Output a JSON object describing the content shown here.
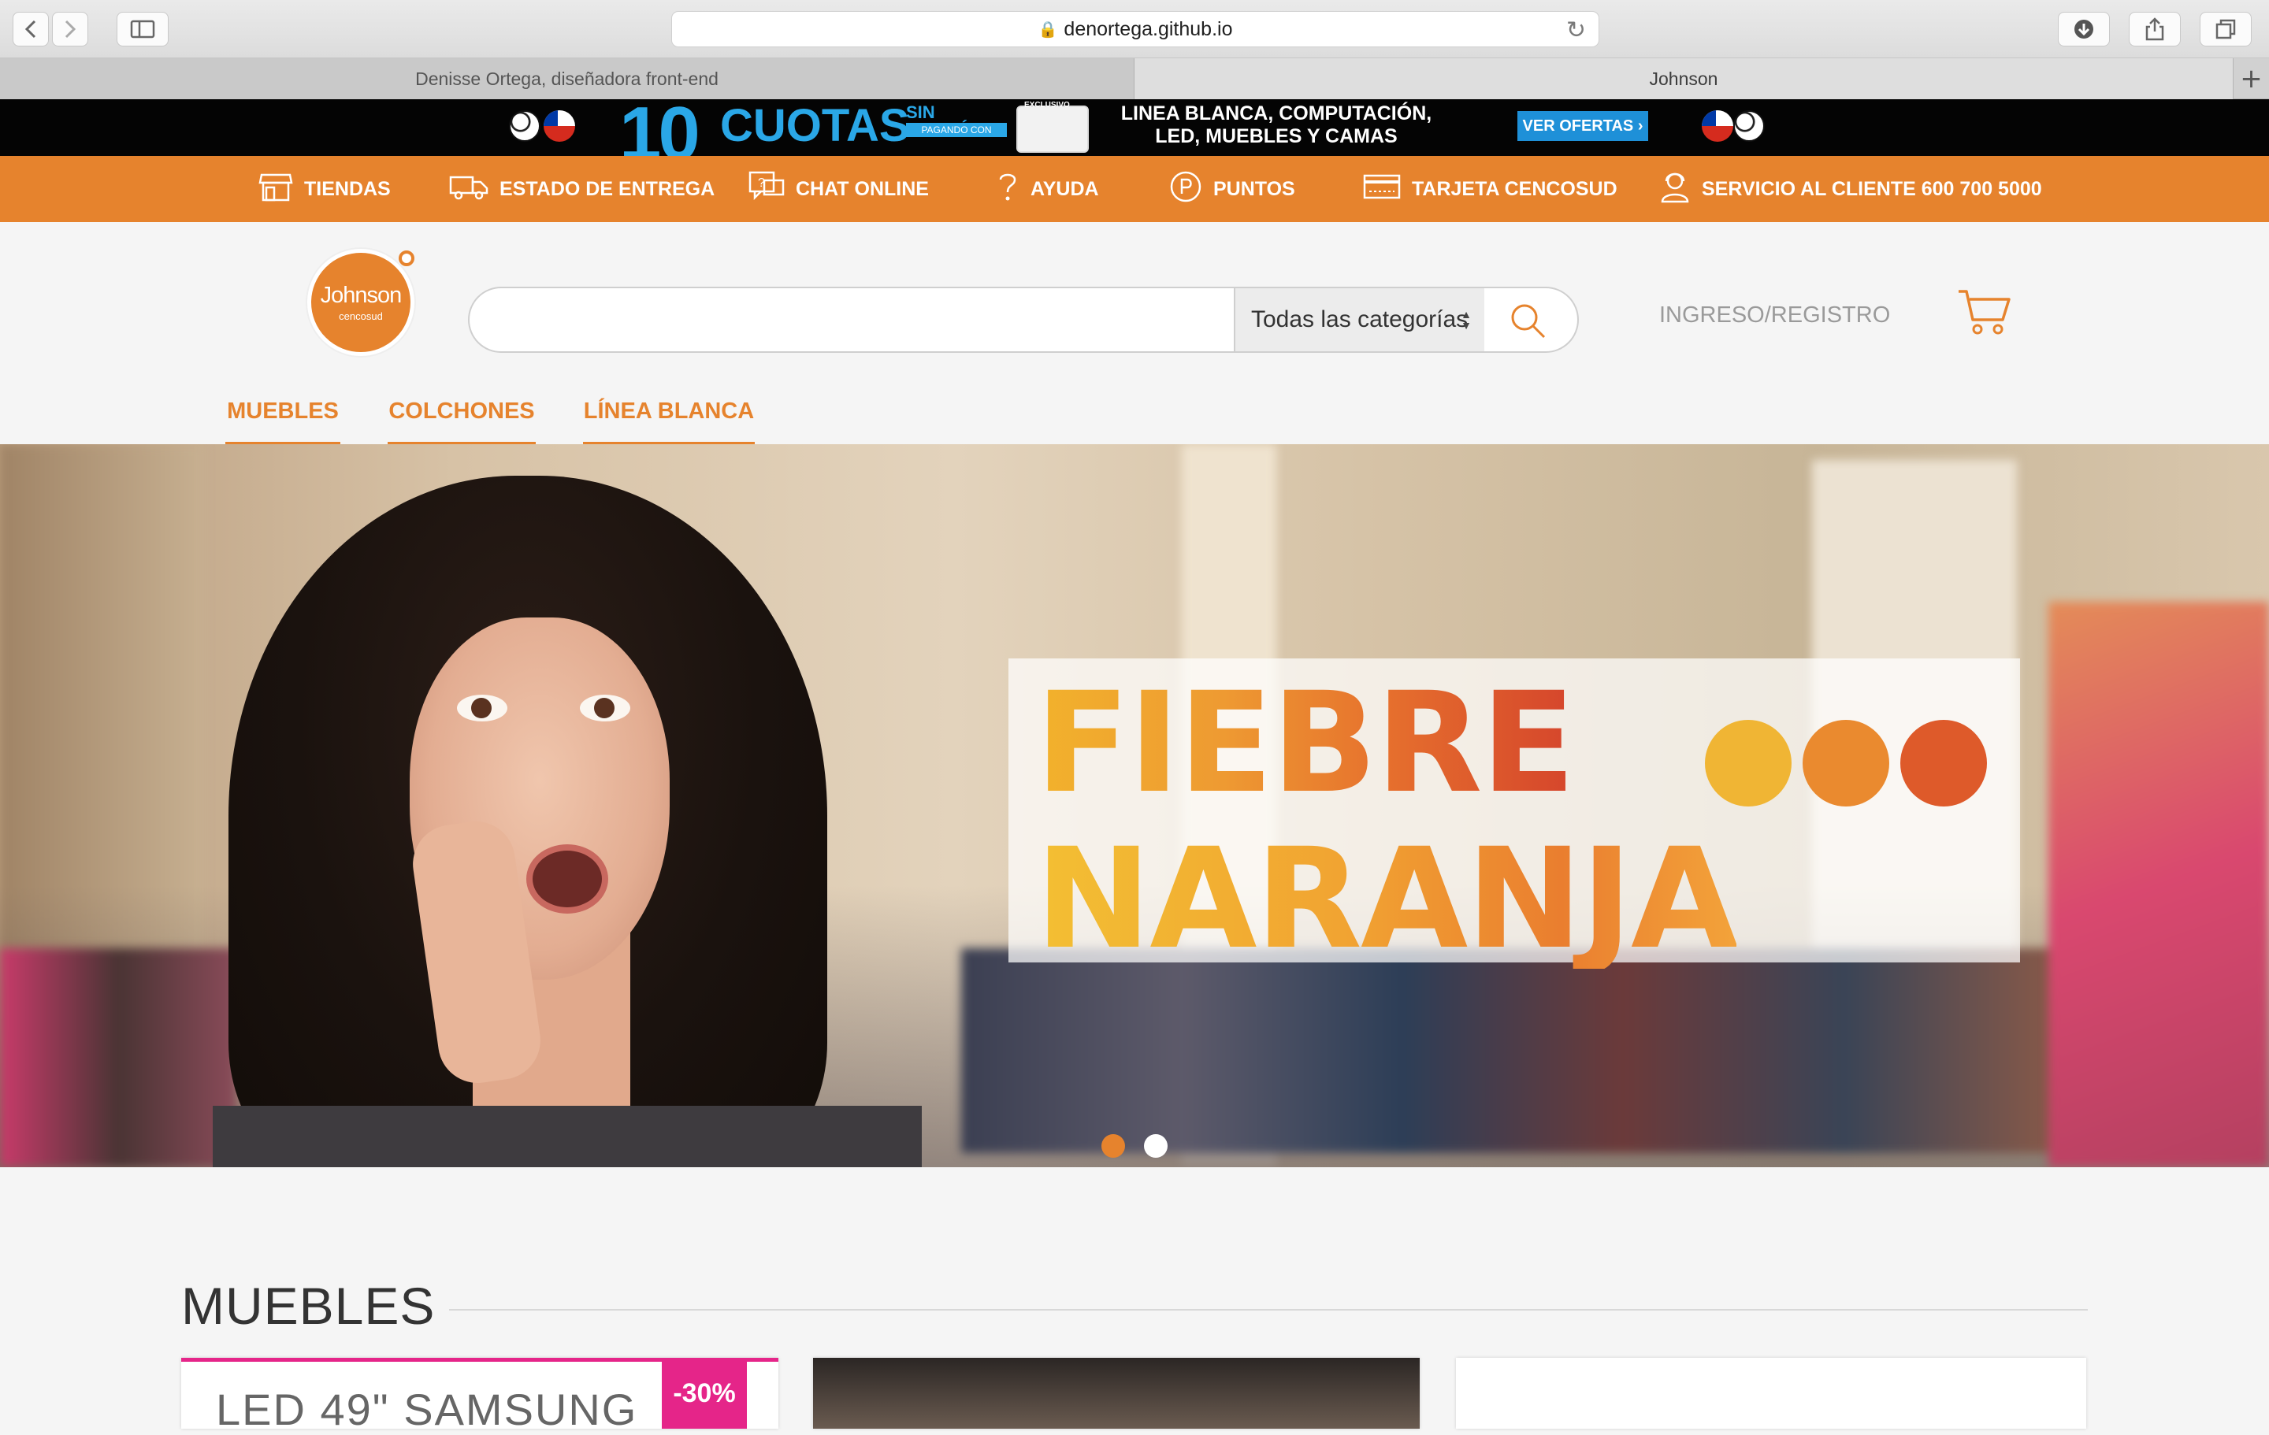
{
  "browser": {
    "url": "denortega.github.io",
    "tabs": [
      {
        "title": "Denisse Ortega, diseñadora front-end"
      },
      {
        "title": "Johnson"
      }
    ],
    "new_tab": "+"
  },
  "promo": {
    "number": "10",
    "cuotas": "CUOTAS",
    "sin_interes": "SIN INTERÉS",
    "pagando_con": "PAGANDO CON",
    "exclusivo": "EXCLUSIVO",
    "text": "LINEA BLANCA, COMPUTACIÓN, LED, MUEBLES Y CAMAS",
    "cta": "VER OFERTAS ›"
  },
  "service_bar": {
    "items": [
      {
        "label": "TIENDAS",
        "icon": "store-icon"
      },
      {
        "label": "ESTADO DE ENTREGA",
        "icon": "truck-icon"
      },
      {
        "label": "CHAT ONLINE",
        "icon": "chat-icon"
      },
      {
        "label": "AYUDA",
        "icon": "help-icon"
      },
      {
        "label": "PUNTOS",
        "icon": "points-icon"
      },
      {
        "label": "TARJETA CENCOSUD",
        "icon": "card-icon"
      },
      {
        "label": "SERVICIO AL CLIENTE 600 700 5000",
        "icon": "customer-service-icon"
      }
    ]
  },
  "header": {
    "logo_name": "Johnson",
    "logo_sub": "cencosud",
    "search_placeholder": "",
    "category_select": "Todas las categorías",
    "login": "INGRESO/REGISTRO"
  },
  "categories": [
    "MUEBLES",
    "COLCHONES",
    "LÍNEA BLANCA"
  ],
  "hero": {
    "title_line_1": "FIEBRE",
    "title_line_2": "NARANJA",
    "dot_colors": [
      "#f0b534",
      "#ea8a2f",
      "#de5a2a"
    ],
    "carousel": {
      "count": 2,
      "active_index": 0,
      "active_color": "#e6832d",
      "inactive_color": "#ffffff"
    }
  },
  "section": {
    "title": "MUEBLES",
    "products": [
      {
        "title": "LED 49\" SAMSUNG",
        "badge": "-30%"
      }
    ]
  },
  "colors": {
    "brand_orange": "#e6832d",
    "promo_blue": "#2aa7e7",
    "badge_pink": "#e52589"
  }
}
